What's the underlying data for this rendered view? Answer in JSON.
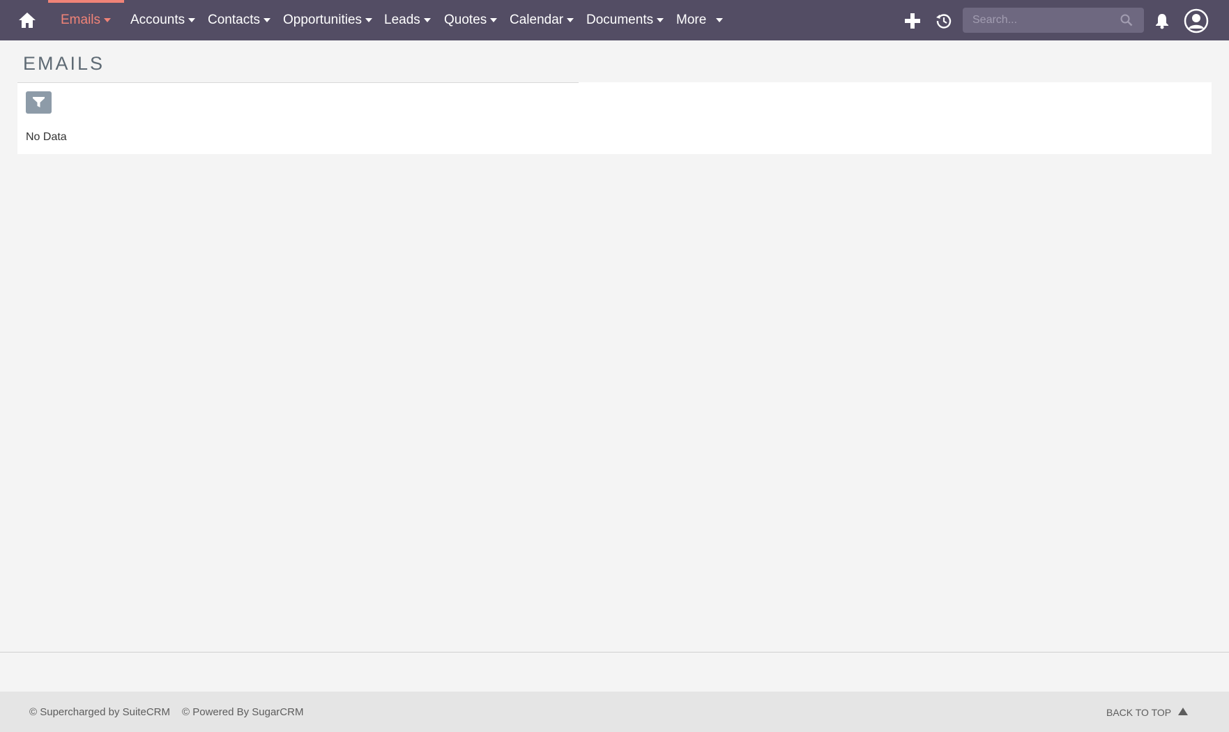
{
  "colors": {
    "navbar_bg": "#534d64",
    "active_accent": "#f08377",
    "page_bg": "#f4f4f4",
    "filter_button": "#8d9ba8"
  },
  "navbar": {
    "home_icon": "home-icon",
    "items": [
      {
        "label": "Emails",
        "active": true
      },
      {
        "label": "Accounts"
      },
      {
        "label": "Contacts"
      },
      {
        "label": "Opportunities"
      },
      {
        "label": "Leads"
      },
      {
        "label": "Quotes"
      },
      {
        "label": "Calendar"
      },
      {
        "label": "Documents"
      },
      {
        "label": "More"
      }
    ],
    "quick_create_icon": "plus-icon",
    "recent_icon": "history-icon",
    "search": {
      "placeholder": "Search...",
      "value": "",
      "icon": "search-icon"
    },
    "notifications_icon": "bell-icon",
    "profile_icon": "user-circle-icon"
  },
  "main": {
    "title": "EMAILS",
    "filter_icon": "filter-icon",
    "empty_text": "No Data"
  },
  "footer": {
    "supercharged": "© Supercharged by SuiteCRM",
    "powered": "© Powered By SugarCRM",
    "back_to_top": "BACK TO TOP"
  }
}
